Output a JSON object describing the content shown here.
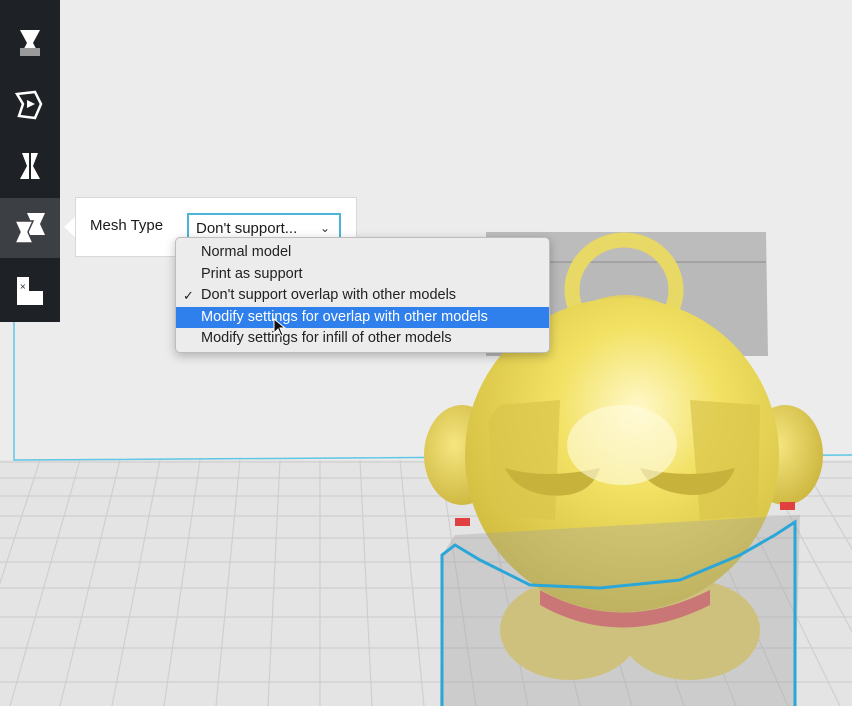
{
  "toolbar": {
    "tools": [
      {
        "icon": "move-tool-icon"
      },
      {
        "icon": "rotate-tool-icon"
      },
      {
        "icon": "mirror-tool-icon"
      },
      {
        "icon": "per-model-settings-icon",
        "active": true
      },
      {
        "icon": "support-blocker-icon"
      }
    ]
  },
  "panel": {
    "mesh_type_label": "Mesh Type",
    "selected_value": "Don't support..."
  },
  "dropdown": {
    "options": [
      {
        "label": "Normal model",
        "checked": false,
        "highlighted": false
      },
      {
        "label": "Print as support",
        "checked": false,
        "highlighted": false
      },
      {
        "label": "Don't support overlap with other models",
        "checked": true,
        "highlighted": false
      },
      {
        "label": "Modify settings for overlap with other models",
        "checked": false,
        "highlighted": true
      },
      {
        "label": "Modify settings for infill of other models",
        "checked": false,
        "highlighted": false
      }
    ],
    "check_glyph": "✓"
  },
  "colors": {
    "toolbar_bg": "#1e2125",
    "accent": "#49b5d8",
    "highlight": "#2f7fec",
    "model_yellow": "#f0dc5a",
    "build_plate_grid": "#d0d0d0"
  }
}
